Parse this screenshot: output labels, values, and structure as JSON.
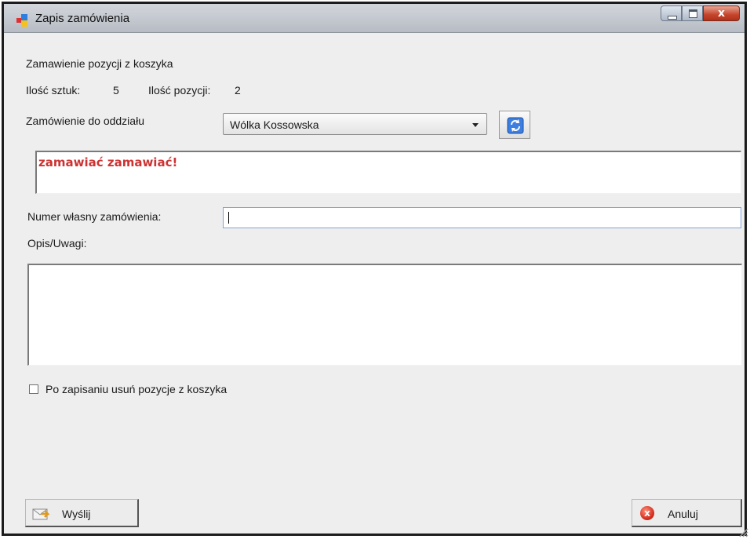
{
  "window": {
    "title": "Zapis zamówienia"
  },
  "order": {
    "heading": "Zamawienie pozycji z koszyka",
    "qty_label": "Ilość sztuk:",
    "qty_value": "5",
    "positions_label": "Ilość pozycji:",
    "positions_value": "2",
    "branch_label": "Zamówienie do oddziału",
    "branch_selected": "Wólka Kossowska",
    "message": "zamawiać zamawiać!",
    "own_number_label": "Numer własny zamówienia:",
    "own_number_value": "",
    "notes_label": "Opis/Uwagi:",
    "notes_value": "",
    "clear_cart_label": "Po zapisaniu usuń pozycje z koszyka",
    "clear_cart_checked": false
  },
  "buttons": {
    "send": "Wyślij",
    "cancel": "Anuluj"
  },
  "icons": {
    "app": "app-icon",
    "refresh": "refresh-icon",
    "send": "send-icon",
    "cancel": "cancel-icon"
  },
  "colors": {
    "message_text": "#cc3333",
    "close_button": "#c4452b",
    "input_border_focus": "#7ea6d8"
  }
}
